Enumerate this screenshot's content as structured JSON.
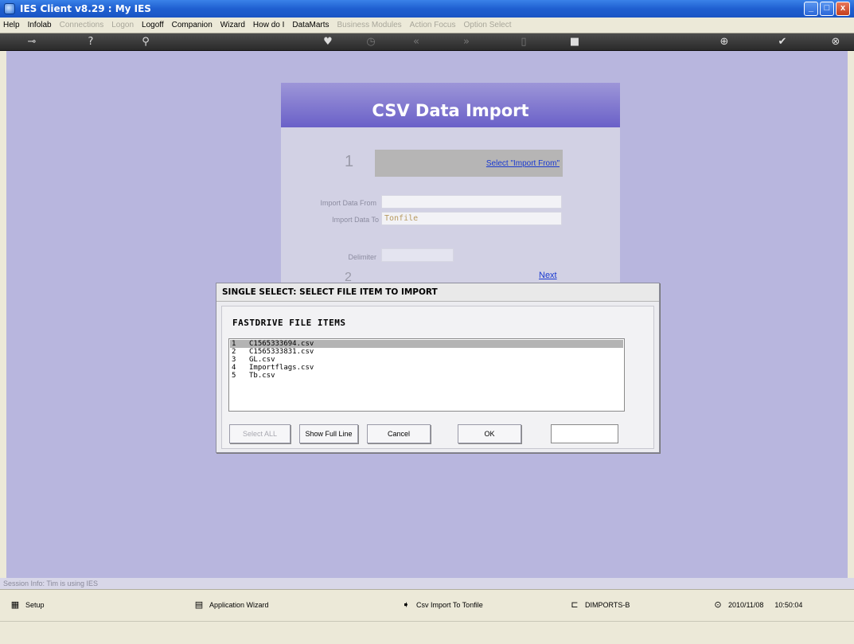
{
  "window": {
    "title": "IES Client v8.29 : My IES",
    "buttons": {
      "minimize": "_",
      "maximize": "□",
      "close": "x"
    }
  },
  "menu": [
    {
      "label": "Help",
      "enabled": true
    },
    {
      "label": "Infolab",
      "enabled": true
    },
    {
      "label": "Connections",
      "enabled": false
    },
    {
      "label": "Logon",
      "enabled": false
    },
    {
      "label": "Logoff",
      "enabled": true
    },
    {
      "label": "Companion",
      "enabled": true
    },
    {
      "label": "Wizard",
      "enabled": true
    },
    {
      "label": "How do I",
      "enabled": true
    },
    {
      "label": "DataMarts",
      "enabled": true
    },
    {
      "label": "Business Modules",
      "enabled": false
    },
    {
      "label": "Action Focus",
      "enabled": false
    },
    {
      "label": "Option Select",
      "enabled": false
    }
  ],
  "toolbar_icons": [
    "key-icon",
    "help-icon",
    "search-icon",
    "heart-icon",
    "clock-icon",
    "back-icon",
    "forward-icon",
    "page-icon",
    "stop-icon",
    "plus-icon",
    "check-icon",
    "close-icon"
  ],
  "form": {
    "header": "CSV Data Import",
    "step1_number": "1",
    "step1_link": "Select \"Import From\"",
    "import_from_label": "Import Data From",
    "import_from_value": "",
    "import_to_label": "Import Data To",
    "import_to_value": "Tonfile",
    "delimiter_label": "Delimiter",
    "delimiter_value": "",
    "step2_number": "2",
    "next_link": "Next"
  },
  "dialog": {
    "title": "SINGLE SELECT: SELECT FILE ITEM TO IMPORT",
    "heading": "FASTDRIVE FILE ITEMS",
    "items": [
      {
        "index": "1",
        "name": "C1565333694.csv",
        "selected": true
      },
      {
        "index": "2",
        "name": "C1565333831.csv",
        "selected": false
      },
      {
        "index": "3",
        "name": "GL.csv",
        "selected": false
      },
      {
        "index": "4",
        "name": "Importflags.csv",
        "selected": false
      },
      {
        "index": "5",
        "name": "Tb.csv",
        "selected": false
      }
    ],
    "buttons": {
      "select_all": "Select ALL",
      "show_full_line": "Show Full Line",
      "cancel": "Cancel",
      "ok": "OK"
    },
    "input_value": ""
  },
  "session": "Session Info: Tim is using IES",
  "taskbar": {
    "setup": "Setup",
    "app_wizard": "Application Wizard",
    "csv_import": "Csv Import To Tonfile",
    "dimports": "DIMPORTS-B",
    "date": "2010/11/08",
    "time": "10:50:04"
  }
}
